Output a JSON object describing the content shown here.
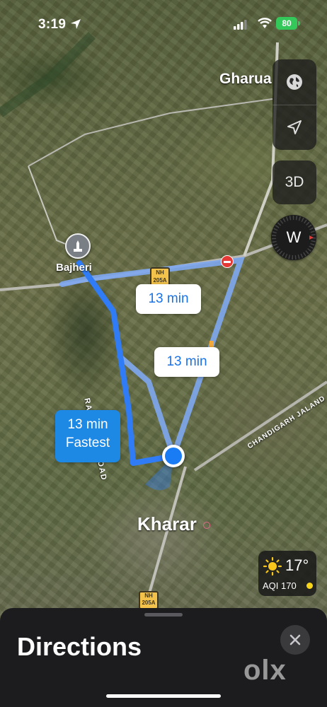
{
  "status_bar": {
    "time": "3:19",
    "battery": "80"
  },
  "map_controls": {
    "mode_3d": "3D",
    "compass_letter": "W"
  },
  "places": {
    "gharuan": "Gharua",
    "bajheri": "Bajheri",
    "kharar": "Kharar"
  },
  "roads": {
    "nh_badge_top": "NH",
    "nh_badge_num": "205A",
    "nh_badge_bottom_top": "NH",
    "nh_badge_bottom_num": "205A",
    "randhawa_road": "RANDHAWA ROAD",
    "chandigarh_road": "CHANDIGARH JALAND"
  },
  "routes": [
    {
      "eta": "13 min",
      "note": ""
    },
    {
      "eta": "13 min",
      "note": ""
    },
    {
      "eta": "13 min",
      "note": "Fastest"
    }
  ],
  "weather": {
    "temperature": "17°",
    "aqi": "AQI 170"
  },
  "sheet": {
    "title": "Directions",
    "watermark": "olx"
  },
  "colors": {
    "route_primary": "#2f7cf6",
    "route_alt": "#7ea7f0",
    "fast_badge": "#1e88e5",
    "user_dot": "#1a7cf5"
  }
}
